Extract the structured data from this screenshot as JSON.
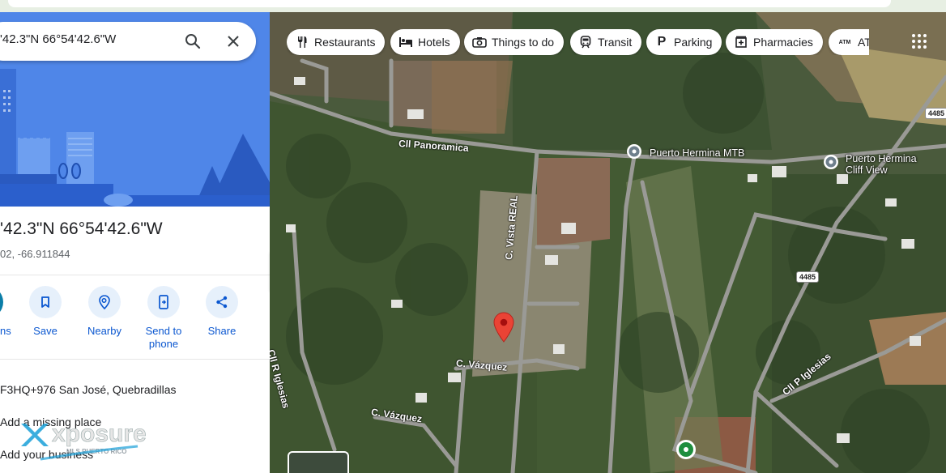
{
  "search": {
    "query": "'42.3\"N 66°54'42.6\"W"
  },
  "place": {
    "title": "'42.3\"N 66°54'42.6\"W",
    "coords": "02, -66.911844"
  },
  "actions": {
    "directions_label": "ns",
    "save_label": "Save",
    "nearby_label": "Nearby",
    "send_label_1": "Send to",
    "send_label_2": "phone",
    "share_label": "Share"
  },
  "info": {
    "plus_code": "F3HQ+976 San José, Quebradillas",
    "missing_place": "Add a missing place",
    "business": "Add your business"
  },
  "watermark": {
    "brand": "xposure",
    "sub": "MLS PUERTO RICO"
  },
  "chips": {
    "restaurants": "Restaurants",
    "hotels": "Hotels",
    "things_to_do": "Things to do",
    "transit": "Transit",
    "parking": "Parking",
    "pharmacies": "Pharmacies",
    "atm": "ATM",
    "atm_icon_text": "ATM"
  },
  "map": {
    "roads": {
      "panoramica": "Cll Panoramica",
      "vista_real": "C. Vista REAL",
      "vazquez_1": "C. Vázquez",
      "vazquez_2": "C. Vázquez",
      "r_iglesias": "Cll R Iglesias",
      "p_iglesias": "Cll P Iglesias"
    },
    "shields": {
      "a": "4485",
      "b": "4485"
    },
    "pois": {
      "mtb": "Puerto Hermina MTB",
      "cliff_1": "Puerto Hermina",
      "cliff_2": "Cliff View"
    }
  },
  "colors": {
    "accent": "#0b57d0",
    "pin": "#ea4335",
    "hero": "#4f86e8",
    "green_pin": "#1e8e3e"
  }
}
